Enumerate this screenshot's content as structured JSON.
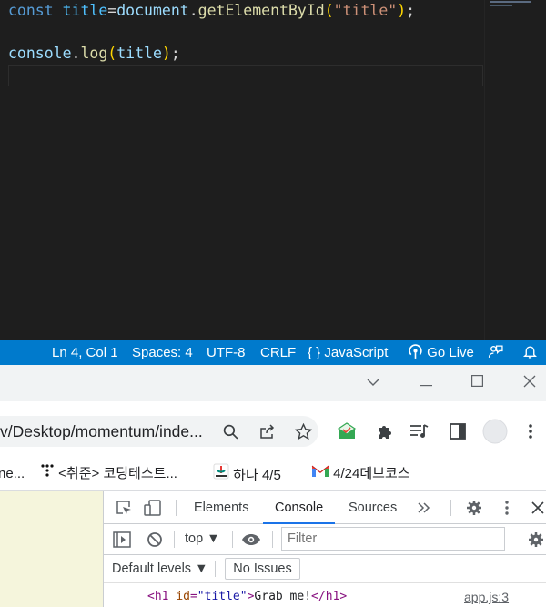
{
  "editor": {
    "line1": {
      "kw": "const",
      "var": "title",
      "op": "=",
      "obj": "document",
      "dot": ".",
      "fn": "getElementById",
      "lparen": "(",
      "str": "\"title\"",
      "rparen": ")",
      "semi": ";"
    },
    "line3": {
      "obj": "console",
      "dot": ".",
      "fn": "log",
      "lparen": "(",
      "var": "title",
      "rparen": ")",
      "semi": ";"
    }
  },
  "statusbar": {
    "position": "Ln 4, Col 1",
    "spaces": "Spaces: 4",
    "encoding": "UTF-8",
    "eol": "CRLF",
    "language_icon": "{ }",
    "language": "JavaScript",
    "golive": "Go Live",
    "accent": "#007acc"
  },
  "browser": {
    "url": "/Desktop/momentum/inde...",
    "url_prefix": "v",
    "bookmarks": [
      {
        "label": "ne..."
      },
      {
        "label": "<취준> 코딩테스트..."
      },
      {
        "label": "하나 4/5"
      },
      {
        "label": "4/24데브코스"
      }
    ]
  },
  "devtools": {
    "tabs": [
      "Elements",
      "Console",
      "Sources"
    ],
    "active_tab": "Console",
    "context": "top",
    "filter_placeholder": "Filter",
    "levels": "Default levels",
    "no_issues": "No Issues",
    "log": {
      "open_tag": "<h1",
      "attr": "id",
      "eq": "=",
      "val": "\"title\"",
      "gt": ">",
      "text": "Grab me!",
      "close_tag": "</h1>",
      "source": "app.js:3"
    }
  }
}
